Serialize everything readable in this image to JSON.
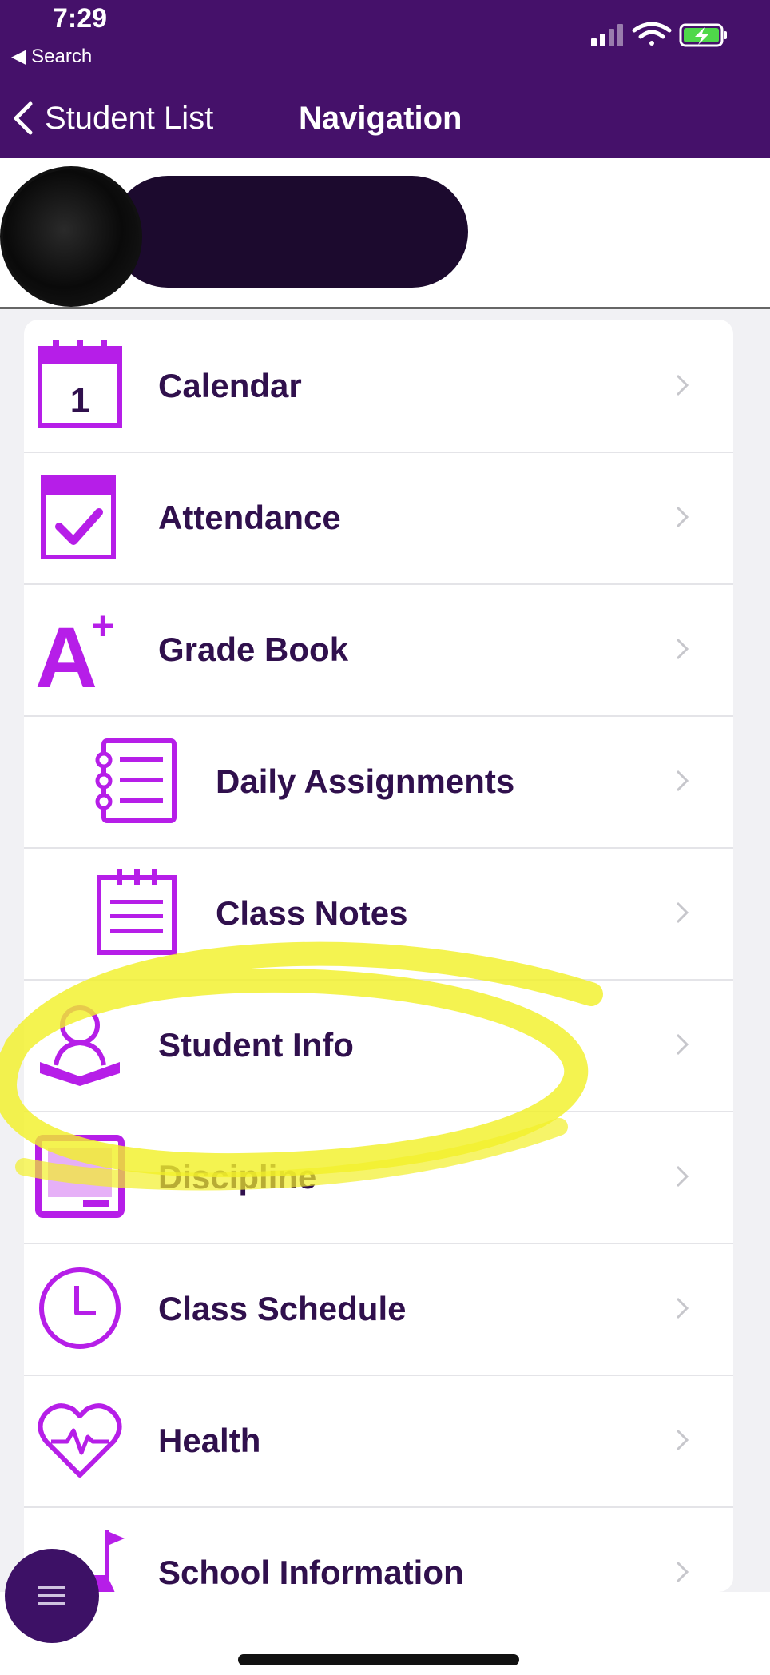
{
  "status": {
    "time": "7:29",
    "back": "◀ Search"
  },
  "nav": {
    "back_label": "Student List",
    "title": "Navigation"
  },
  "menu": [
    {
      "label": "Calendar",
      "icon": "calendar-icon",
      "icon_text": "1"
    },
    {
      "label": "Attendance",
      "icon": "attendance-check-icon"
    },
    {
      "label": "Grade Book",
      "icon": "grade-a-plus-icon",
      "icon_text": "A",
      "icon_sup": "+"
    },
    {
      "label": "Daily Assignments",
      "icon": "notebook-list-icon",
      "indent": true
    },
    {
      "label": "Class Notes",
      "icon": "notepad-icon",
      "indent": true
    },
    {
      "label": "Student Info",
      "icon": "student-reading-icon"
    },
    {
      "label": "Discipline",
      "icon": "discipline-board-icon"
    },
    {
      "label": "Class Schedule",
      "icon": "clock-icon"
    },
    {
      "label": "Health",
      "icon": "heart-pulse-icon"
    },
    {
      "label": "School Information",
      "icon": "school-flag-icon"
    }
  ],
  "colors": {
    "brand_purple": "#45116a",
    "icon_purple": "#b61ee8",
    "text_purple": "#30104d",
    "highlight_yellow": "#f2f02a"
  }
}
